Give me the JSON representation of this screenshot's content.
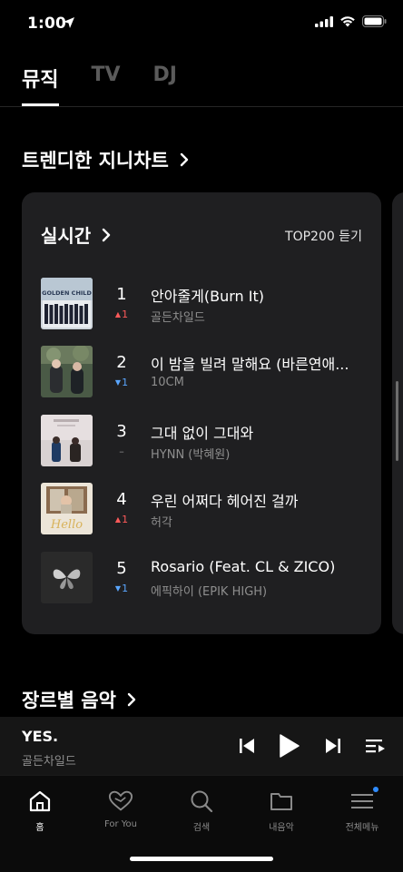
{
  "status_bar": {
    "time": "1:00",
    "location_icon": "location-arrow-icon",
    "signal_icon": "cellular-signal-icon",
    "wifi_icon": "wifi-icon",
    "battery_icon": "battery-icon"
  },
  "top_tabs": [
    {
      "label": "뮤직",
      "active": true
    },
    {
      "label": "TV",
      "active": false
    },
    {
      "label": "DJ",
      "active": false
    }
  ],
  "trending_section": {
    "title": "트렌디한 지니차트"
  },
  "chart_card": {
    "title": "실시간",
    "top200_label": "TOP200 듣기",
    "songs": [
      {
        "rank": "1",
        "delta_dir": "up",
        "delta_value": "1",
        "title": "안아줄게(Burn It)",
        "artist": "골든차일드",
        "art": "golden-child-album-art"
      },
      {
        "rank": "2",
        "delta_dir": "down",
        "delta_value": "1",
        "title": "이 밤을 빌려 말해요 (바른연애...",
        "artist": "10CM",
        "art": "ten-cm-album-art"
      },
      {
        "rank": "3",
        "delta_dir": "same",
        "delta_value": "–",
        "title": "그대 없이 그대와",
        "artist": "HYNN (박혜원)",
        "art": "hynn-album-art"
      },
      {
        "rank": "4",
        "delta_dir": "up",
        "delta_value": "1",
        "title": "우린 어쩌다 헤어진 걸까",
        "artist": "허각",
        "art": "huh-gak-album-art"
      },
      {
        "rank": "5",
        "delta_dir": "down",
        "delta_value": "1",
        "title": "Rosario (Feat. CL & ZICO)",
        "artist": "에픽하이 (EPIK HIGH)",
        "art": "epik-high-album-art"
      }
    ]
  },
  "genre_section": {
    "title": "장르별 음악"
  },
  "now_playing": {
    "title": "YES.",
    "artist": "골든차일드"
  },
  "bottom_nav": [
    {
      "label": "홈",
      "icon": "home-icon",
      "active": true
    },
    {
      "label": "For You",
      "icon": "heart-icon",
      "active": false
    },
    {
      "label": "검색",
      "icon": "search-icon",
      "active": false
    },
    {
      "label": "내음악",
      "icon": "folder-icon",
      "active": false
    },
    {
      "label": "전체메뉴",
      "icon": "menu-icon",
      "active": false,
      "badge": true
    }
  ],
  "colors": {
    "background": "#000000",
    "card": "#1f1f21",
    "rank_up": "#ff5a5a",
    "rank_down": "#5aa6ff",
    "badge": "#2f8cff"
  }
}
